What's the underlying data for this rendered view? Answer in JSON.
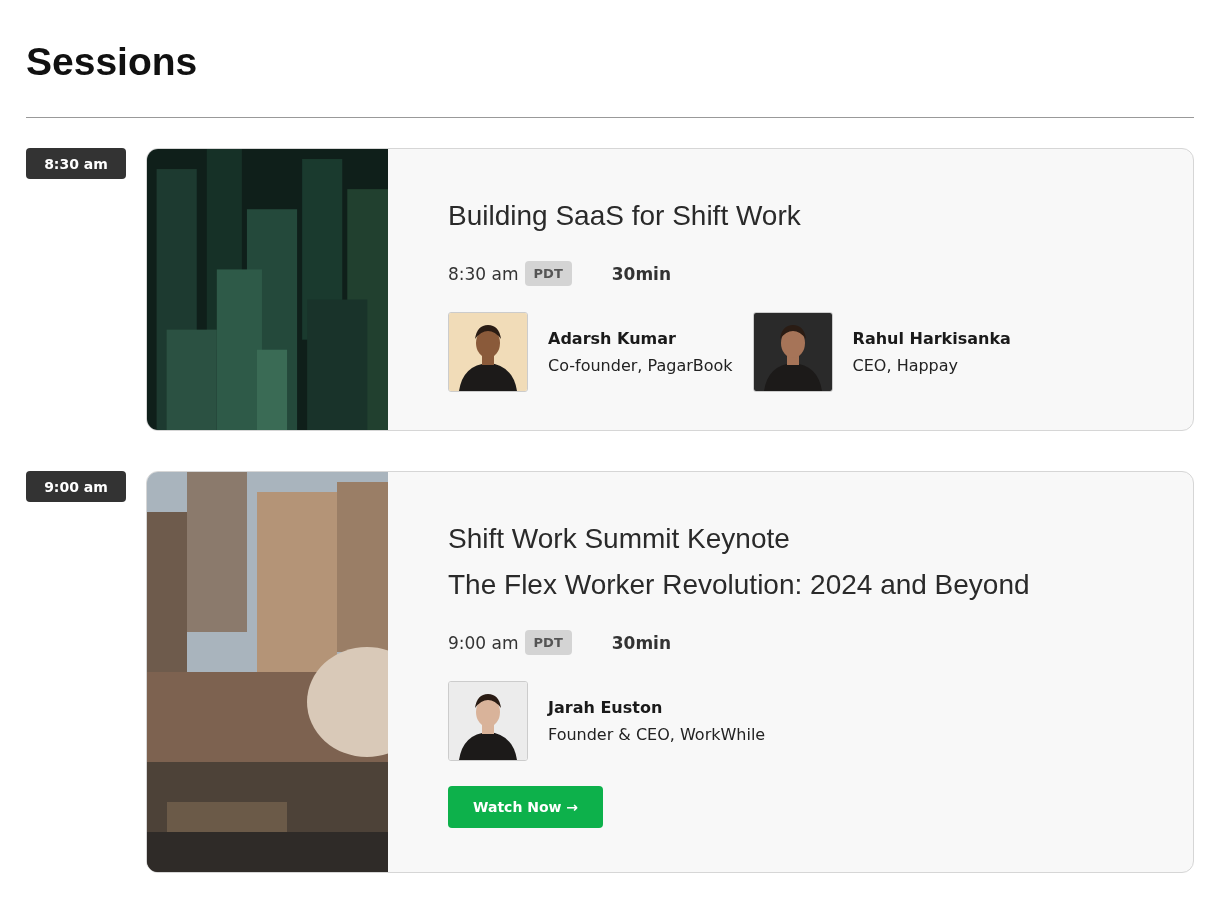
{
  "heading": "Sessions",
  "sessions": [
    {
      "time": "8:30 am",
      "title_lines": [
        "Building SaaS for Shift Work"
      ],
      "start": "8:30 am",
      "timezone": "PDT",
      "duration": "30min",
      "speakers": [
        {
          "name": "Adarsh Kumar",
          "role": "Co-founder, PagarBook"
        },
        {
          "name": "Rahul Harkisanka",
          "role": "CEO, Happay"
        }
      ]
    },
    {
      "time": "9:00 am",
      "title_lines": [
        "Shift Work Summit Keynote",
        "The Flex Worker Revolution: 2024 and Beyond"
      ],
      "start": "9:00 am",
      "timezone": "PDT",
      "duration": "30min",
      "speakers": [
        {
          "name": "Jarah Euston",
          "role": "Founder & CEO, WorkWhile"
        }
      ],
      "button": "Watch Now →"
    }
  ]
}
